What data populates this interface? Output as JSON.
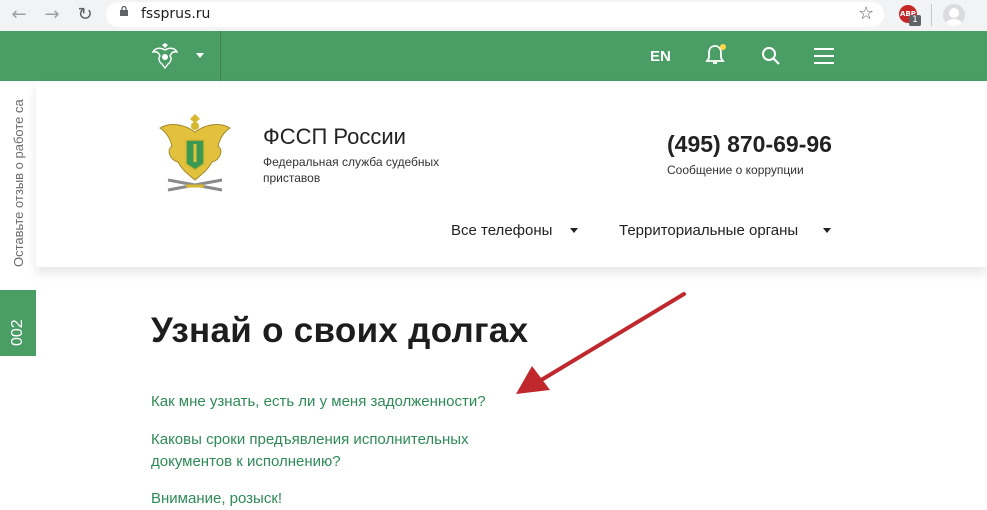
{
  "browser": {
    "url": "fssprus.ru",
    "extension_badge": "ABP",
    "extension_count": "1"
  },
  "topbar": {
    "lang": "EN",
    "color": "#4a9d65"
  },
  "feedback": {
    "label": "Оставьте отзыв о работе са",
    "tab": "002"
  },
  "header": {
    "title": "ФССП России",
    "subtitle": "Федеральная служба судебных приставов",
    "phone": "(495) 870-69-96",
    "phone_note": "Сообщение о коррупции",
    "menu": [
      "Все телефоны",
      "Территориальные органы"
    ]
  },
  "main": {
    "heading": "Узнай о своих долгах",
    "links": [
      "Как мне узнать, есть ли у меня задолженности?",
      "Каковы сроки предъявления исполнительных документов к исполнению?",
      "Внимание, розыск!"
    ]
  },
  "annotation_color": "#c0282d"
}
